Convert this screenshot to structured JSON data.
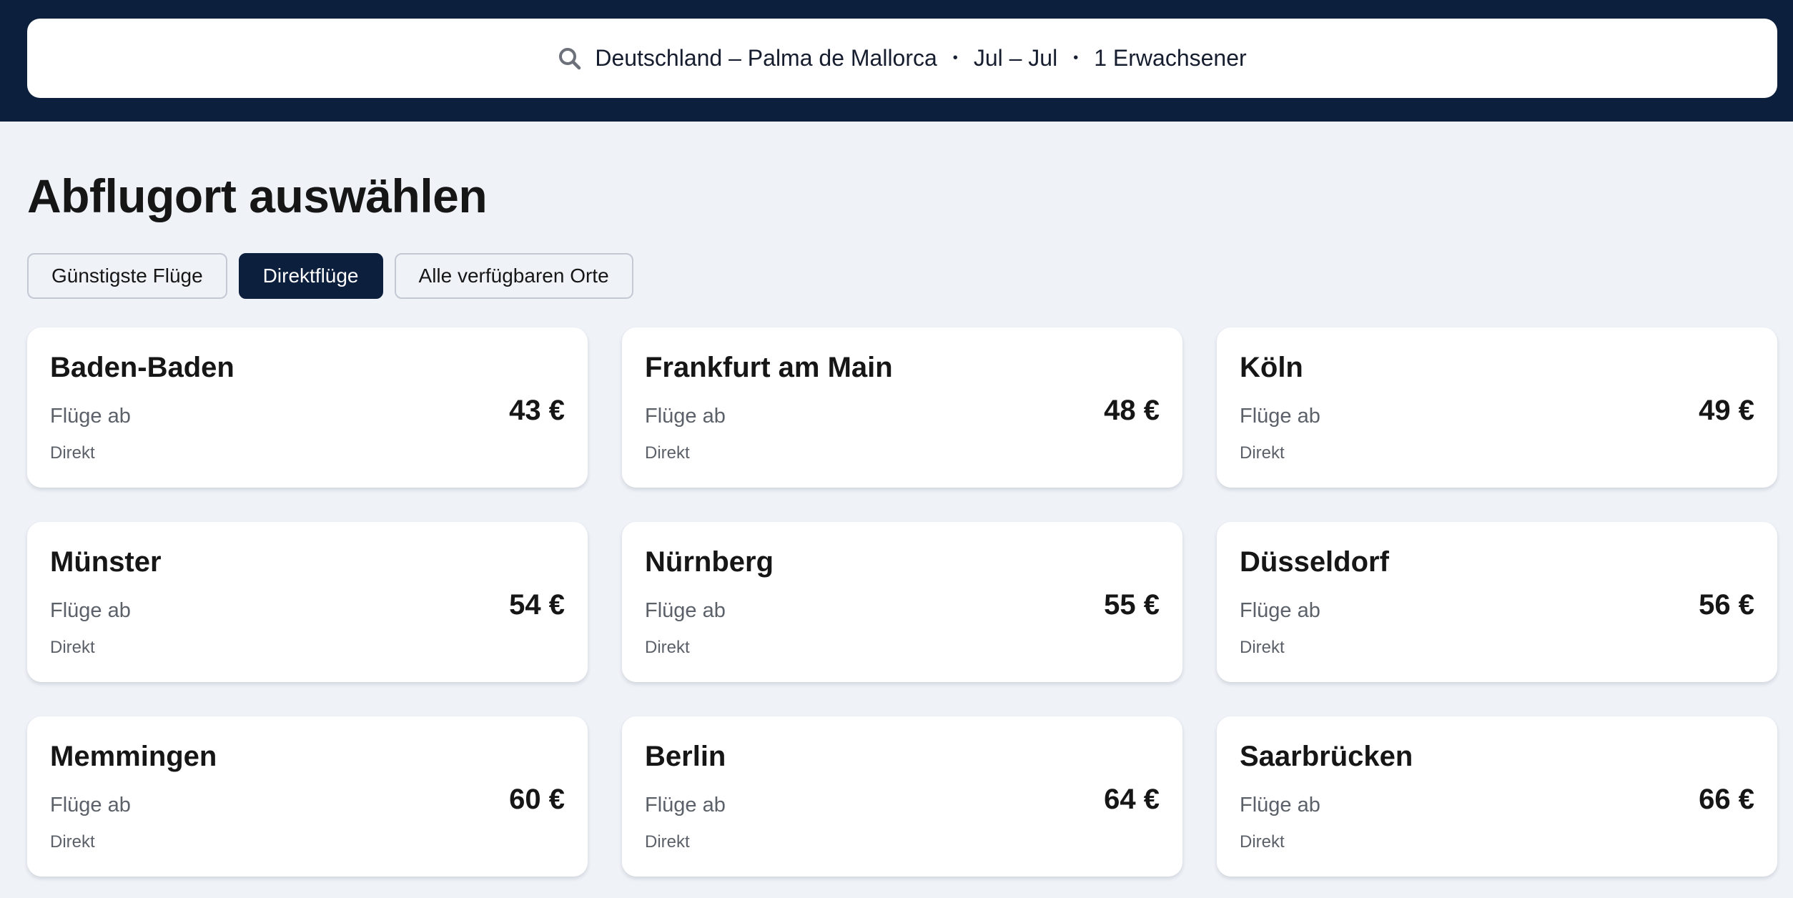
{
  "search": {
    "route": "Deutschland – Palma de Mallorca",
    "dates": "Jul – Jul",
    "travellers": "1 Erwachsener",
    "separator": "•"
  },
  "page_title": "Abflugort auswählen",
  "filters": [
    {
      "label": "Günstigste Flüge",
      "active": false
    },
    {
      "label": "Direktflüge",
      "active": true
    },
    {
      "label": "Alle verfügbaren Orte",
      "active": false
    }
  ],
  "results": [
    {
      "city": "Baden-Baden",
      "from_label": "Flüge ab",
      "price": "43 €",
      "stops": "Direkt"
    },
    {
      "city": "Frankfurt am Main",
      "from_label": "Flüge ab",
      "price": "48 €",
      "stops": "Direkt"
    },
    {
      "city": "Köln",
      "from_label": "Flüge ab",
      "price": "49 €",
      "stops": "Direkt"
    },
    {
      "city": "Münster",
      "from_label": "Flüge ab",
      "price": "54 €",
      "stops": "Direkt"
    },
    {
      "city": "Nürnberg",
      "from_label": "Flüge ab",
      "price": "55 €",
      "stops": "Direkt"
    },
    {
      "city": "Düsseldorf",
      "from_label": "Flüge ab",
      "price": "56 €",
      "stops": "Direkt"
    },
    {
      "city": "Memmingen",
      "from_label": "Flüge ab",
      "price": "60 €",
      "stops": "Direkt"
    },
    {
      "city": "Berlin",
      "from_label": "Flüge ab",
      "price": "64 €",
      "stops": "Direkt"
    },
    {
      "city": "Saarbrücken",
      "from_label": "Flüge ab",
      "price": "66 €",
      "stops": "Direkt"
    }
  ],
  "colors": {
    "header_bg": "#0c1f3d",
    "page_bg": "#eff3f8",
    "active_chip_bg": "#0c1f3d"
  },
  "icons": {
    "search": "search-icon"
  }
}
